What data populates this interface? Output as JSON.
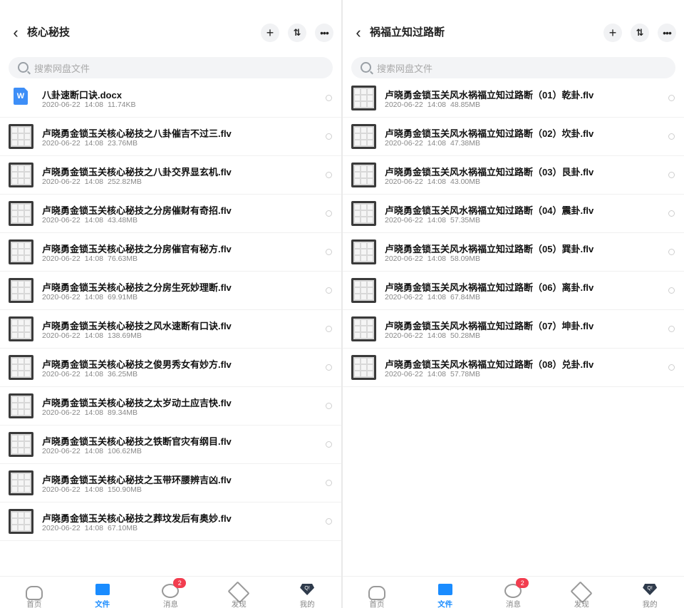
{
  "left": {
    "title": "核心秘技",
    "search_placeholder": "搜索网盘文件",
    "files": [
      {
        "name": "八卦速断口诀.docx",
        "date": "2020-06-22",
        "time": "14:08",
        "size": "11.74KB",
        "icon": "word-doc-icon",
        "icon_label": "W"
      },
      {
        "name": "卢晓勇金锁玉关核心秘技之八卦催吉不过三.flv",
        "date": "2020-06-22",
        "time": "14:08",
        "size": "23.76MB"
      },
      {
        "name": "卢晓勇金锁玉关核心秘技之八卦交界显玄机.flv",
        "date": "2020-06-22",
        "time": "14:08",
        "size": "252.82MB"
      },
      {
        "name": "卢晓勇金锁玉关核心秘技之分房催财有奇招.flv",
        "date": "2020-06-22",
        "time": "14:08",
        "size": "43.48MB"
      },
      {
        "name": "卢晓勇金锁玉关核心秘技之分房催官有秘方.flv",
        "date": "2020-06-22",
        "time": "14:08",
        "size": "76.63MB"
      },
      {
        "name": "卢晓勇金锁玉关核心秘技之分房生死妙理断.flv",
        "date": "2020-06-22",
        "time": "14:08",
        "size": "69.91MB"
      },
      {
        "name": "卢晓勇金锁玉关核心秘技之风水速断有口诀.flv",
        "date": "2020-06-22",
        "time": "14:08",
        "size": "138.69MB"
      },
      {
        "name": "卢晓勇金锁玉关核心秘技之俊男秀女有妙方.flv",
        "date": "2020-06-22",
        "time": "14:08",
        "size": "36.25MB"
      },
      {
        "name": "卢晓勇金锁玉关核心秘技之太岁动土应吉快.flv",
        "date": "2020-06-22",
        "time": "14:08",
        "size": "89.34MB"
      },
      {
        "name": "卢晓勇金锁玉关核心秘技之铁断官灾有纲目.flv",
        "date": "2020-06-22",
        "time": "14:08",
        "size": "106.62MB"
      },
      {
        "name": "卢晓勇金锁玉关核心秘技之玉带环腰辨吉凶.flv",
        "date": "2020-06-22",
        "time": "14:08",
        "size": "150.90MB"
      },
      {
        "name": "卢晓勇金锁玉关核心秘技之葬坟发后有奥妙.flv",
        "date": "2020-06-22",
        "time": "14:08",
        "size": "67.10MB"
      }
    ]
  },
  "right": {
    "title": "祸福立知过路断",
    "search_placeholder": "搜索网盘文件",
    "files": [
      {
        "name": "卢晓勇金锁玉关风水祸福立知过路断（01）乾卦.flv",
        "date": "2020-06-22",
        "time": "14:08",
        "size": "48.85MB"
      },
      {
        "name": "卢晓勇金锁玉关风水祸福立知过路断（02）坎卦.flv",
        "date": "2020-06-22",
        "time": "14:08",
        "size": "47.38MB"
      },
      {
        "name": "卢晓勇金锁玉关风水祸福立知过路断（03）艮卦.flv",
        "date": "2020-06-22",
        "time": "14:08",
        "size": "43.00MB"
      },
      {
        "name": "卢晓勇金锁玉关风水祸福立知过路断（04）震卦.flv",
        "date": "2020-06-22",
        "time": "14:08",
        "size": "57.35MB"
      },
      {
        "name": "卢晓勇金锁玉关风水祸福立知过路断（05）巽卦.flv",
        "date": "2020-06-22",
        "time": "14:08",
        "size": "58.09MB"
      },
      {
        "name": "卢晓勇金锁玉关风水祸福立知过路断（06）离卦.flv",
        "date": "2020-06-22",
        "time": "14:08",
        "size": "67.84MB"
      },
      {
        "name": "卢晓勇金锁玉关风水祸福立知过路断（07）坤卦.flv",
        "date": "2020-06-22",
        "time": "14:08",
        "size": "50.28MB"
      },
      {
        "name": "卢晓勇金锁玉关风水祸福立知过路断（08）兑卦.flv",
        "date": "2020-06-22",
        "time": "14:08",
        "size": "57.78MB"
      }
    ]
  },
  "tabbar": {
    "home": "首页",
    "files": "文件",
    "messages": "消息",
    "messages_badge": "2",
    "discover": "发现",
    "mine": "我的",
    "mine_icon_text": "Q!",
    "active": "files",
    "accent_color": "#1a8cff",
    "badge_color": "#f23d4f"
  }
}
